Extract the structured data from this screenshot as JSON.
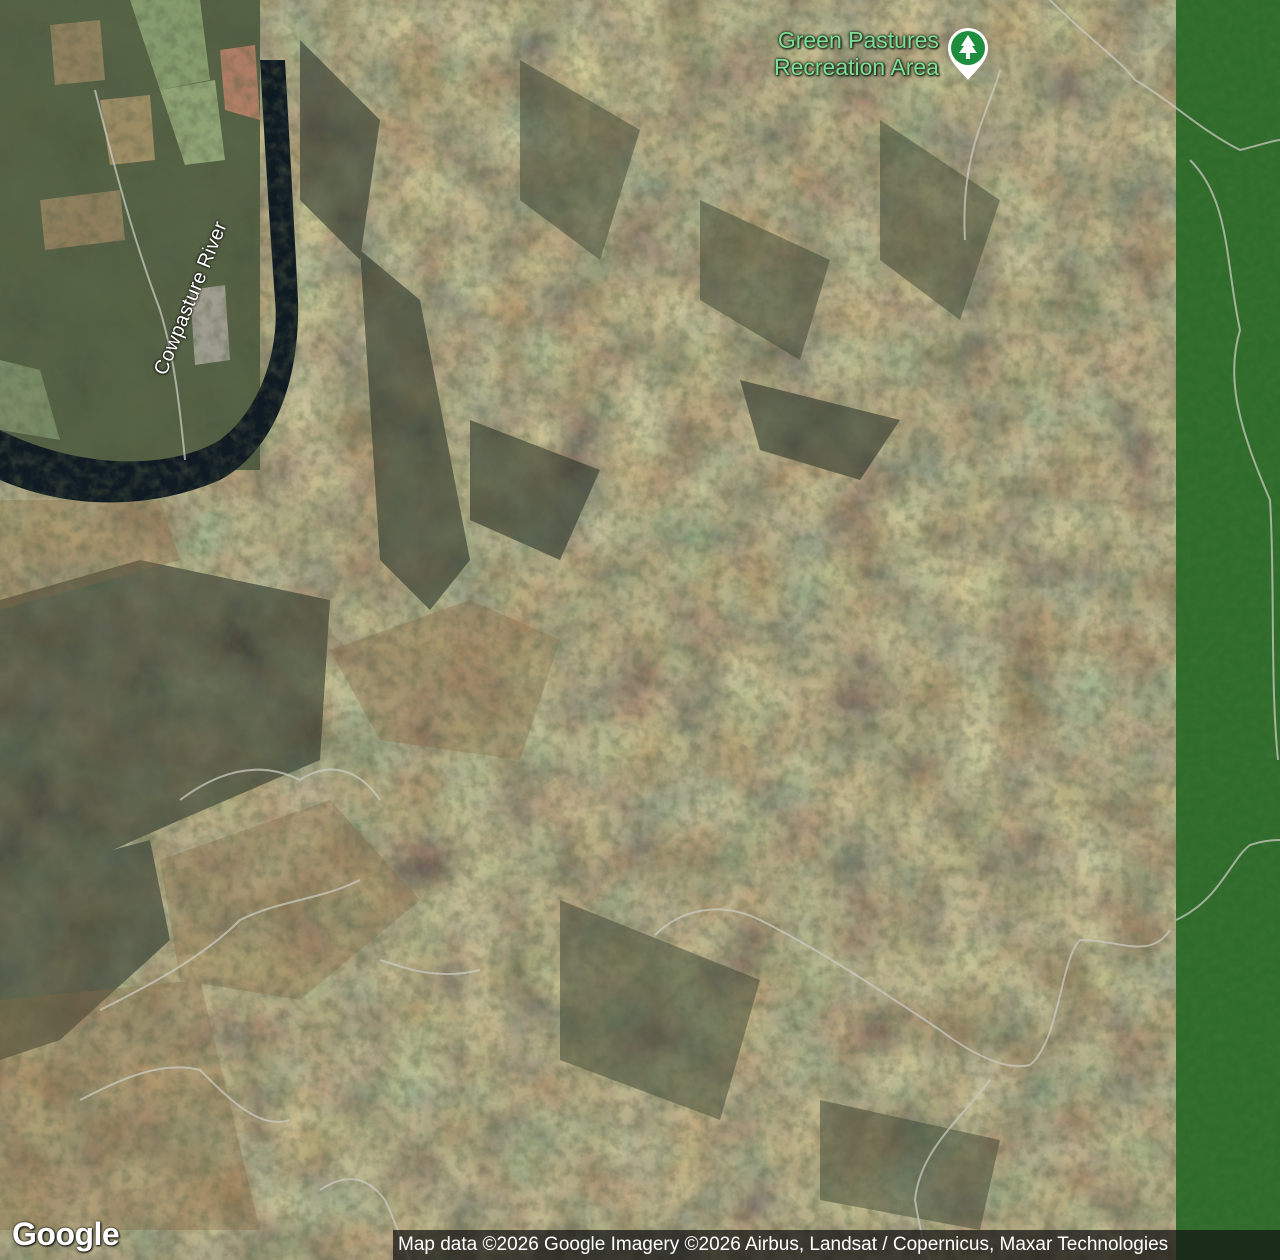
{
  "map": {
    "type": "satellite",
    "poi": {
      "name_line1": "Green Pastures",
      "name_line2": "Recreation Area",
      "icon": "tree-icon",
      "pin_color": "#1e8e3e",
      "label_color": "#7ddf93"
    },
    "river_label": "Cowpasture River",
    "logo": "Google",
    "attribution": "Map data ©2026 Google Imagery ©2026 Airbus, Landsat / Copernicus, Maxar Technologies"
  }
}
